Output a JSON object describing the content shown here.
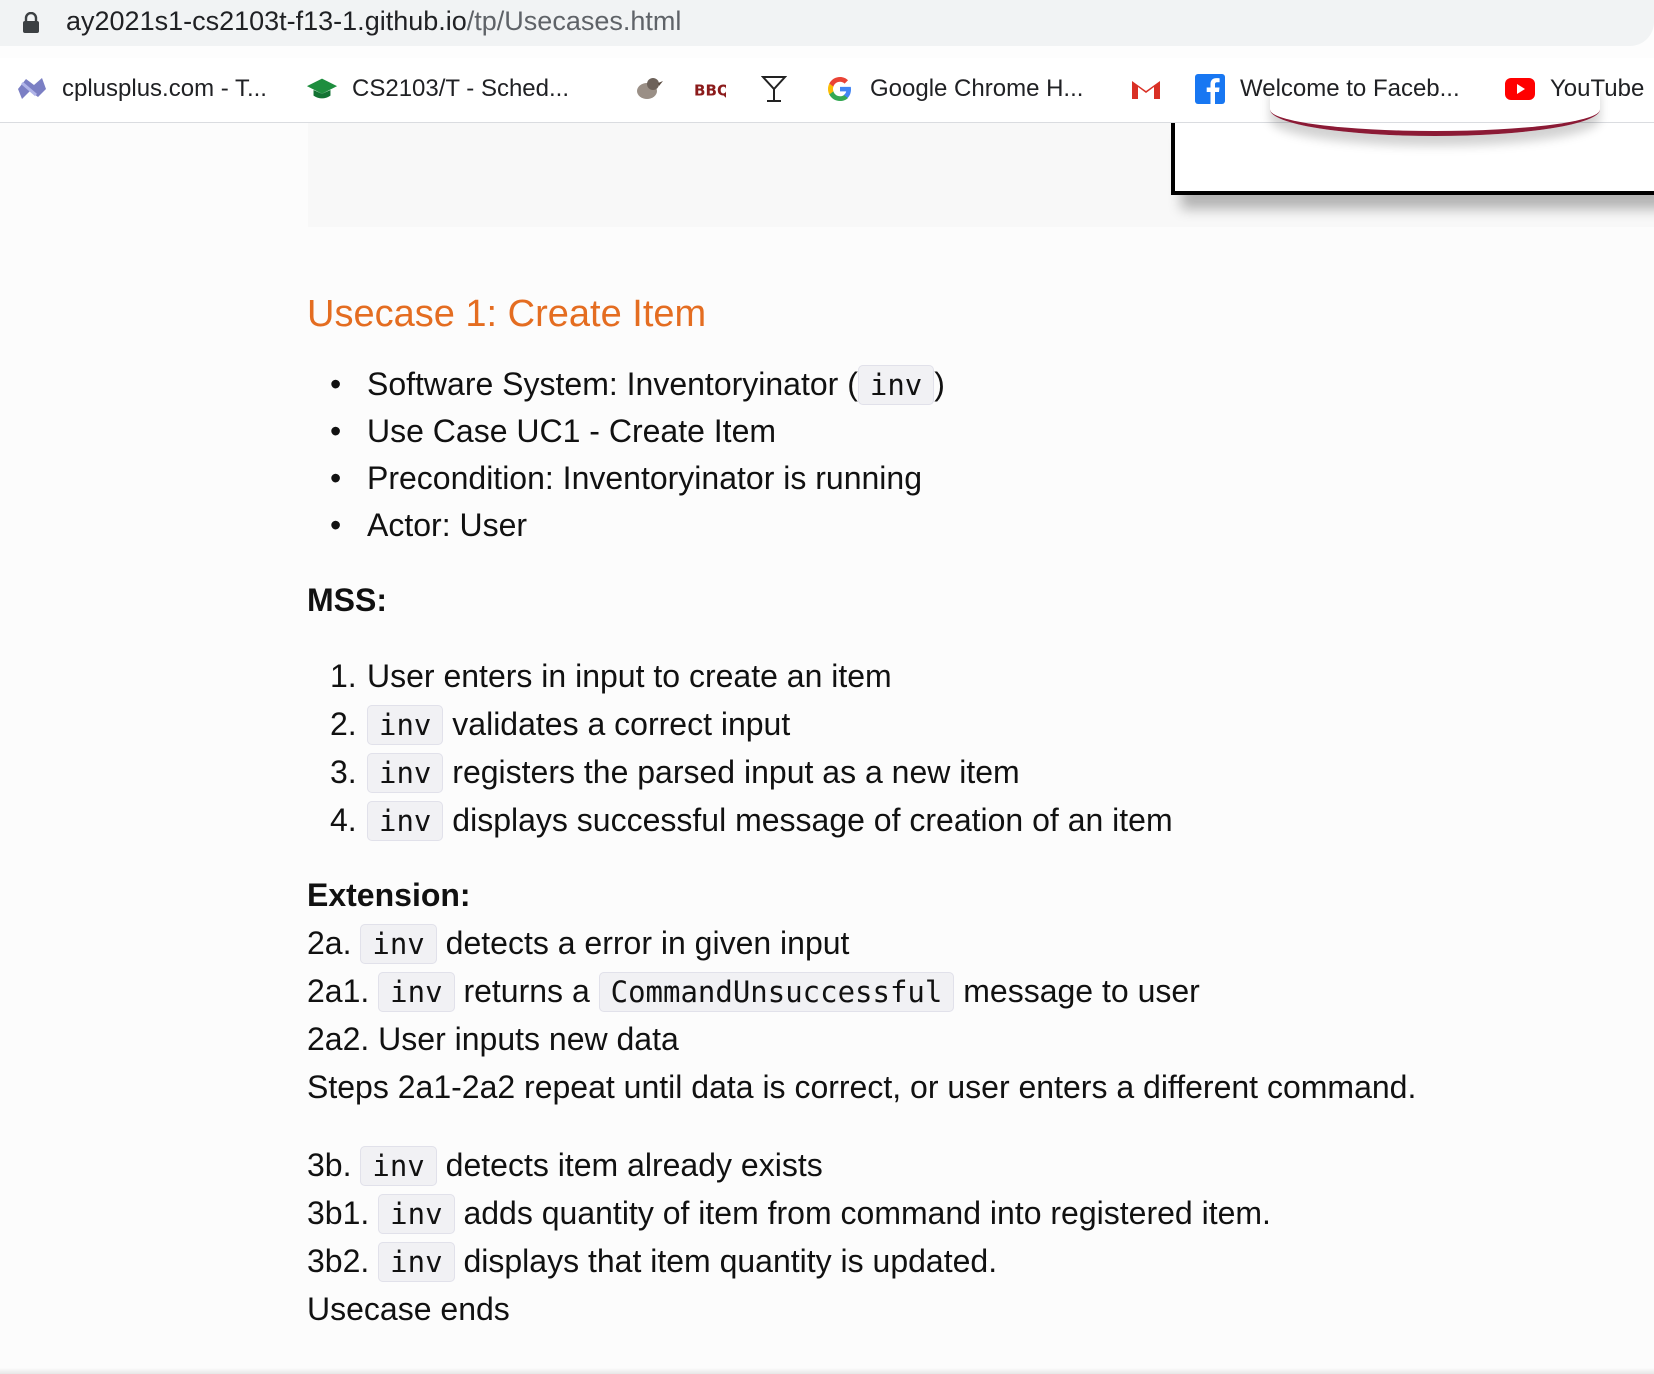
{
  "browser": {
    "url_host": "ay2021s1-cs2103t-f13-1.github.io",
    "url_path": "/tp/Usecases.html",
    "bookmarks": [
      {
        "label": "cplusplus.com - T...",
        "icon": "cplusplus-icon"
      },
      {
        "label": "CS2103/T - Sched...",
        "icon": "graduation-cap-icon"
      },
      {
        "label": "",
        "icon": "bird-icon"
      },
      {
        "label": "",
        "icon": "bbq-icon"
      },
      {
        "label": "",
        "icon": "cocktail-glass-icon"
      },
      {
        "label": "Google Chrome H...",
        "icon": "google-icon"
      },
      {
        "label": "",
        "icon": "gmail-icon"
      },
      {
        "label": "Welcome to Faceb...",
        "icon": "facebook-icon"
      },
      {
        "label": "YouTube",
        "icon": "youtube-icon"
      }
    ]
  },
  "doc": {
    "title": "Usecase 1: Create Item",
    "info": {
      "system_prefix": "Software System: Inventoryinator (",
      "system_code": "inv",
      "system_suffix": ")",
      "use_case": "Use Case UC1 - Create Item",
      "precondition": "Precondition: Inventoryinator is running",
      "actor": "Actor: User"
    },
    "mss_heading": "MSS:",
    "mss": [
      {
        "n": "1.",
        "code": "",
        "text": "User enters in input to create an item"
      },
      {
        "n": "2.",
        "code": "inv",
        "text": "validates a correct input"
      },
      {
        "n": "3.",
        "code": "inv",
        "text": "registers the parsed input as a new item"
      },
      {
        "n": "4.",
        "code": "inv",
        "text": "displays successful message of creation of an item"
      }
    ],
    "ext_heading": "Extension:",
    "ext": {
      "l1_prefix": "2a.",
      "l1_code": "inv",
      "l1_text": "detects a error in given input",
      "l2_prefix": "2a1.",
      "l2_code": "inv",
      "l2_mid": "returns a",
      "l2_code2": "CommandUnsuccessful",
      "l2_text": "message to user",
      "l3": "2a2. User inputs new data",
      "l4": "Steps 2a1-2a2 repeat until data is correct, or user enters a different command.",
      "l5_prefix": "3b.",
      "l5_code": "inv",
      "l5_text": "detects item already exists",
      "l6_prefix": "3b1.",
      "l6_code": "inv",
      "l6_text": "adds quantity of item from command into registered item.",
      "l7_prefix": "3b2.",
      "l7_code": "inv",
      "l7_text": "displays that item quantity is updated.",
      "l8": "Usecase ends"
    }
  },
  "colors": {
    "heading": "#e46d21",
    "code_bg": "#f1f1f4"
  }
}
